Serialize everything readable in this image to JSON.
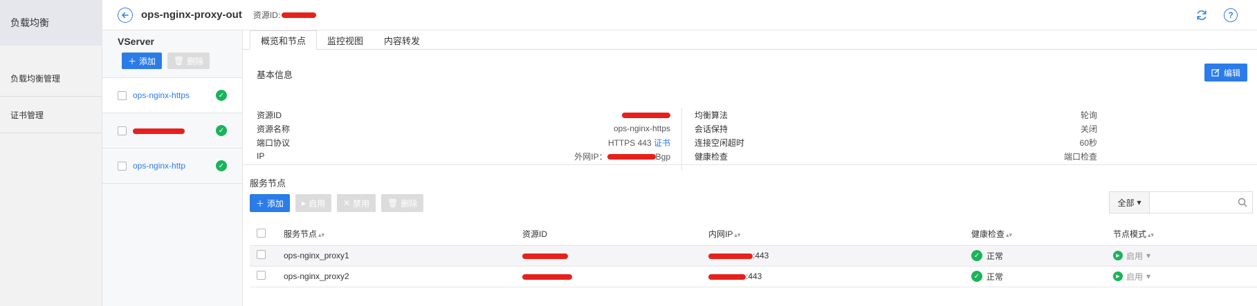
{
  "nav": {
    "header": "负载均衡",
    "items": [
      {
        "label": "负载均衡管理"
      },
      {
        "label": "证书管理"
      }
    ]
  },
  "topbar": {
    "title": "ops-nginx-proxy-out",
    "resource_id_label": "资源ID:",
    "help_glyph": "?"
  },
  "vserver": {
    "title": "VServer",
    "add_label": "添加",
    "delete_label": "删除",
    "items": [
      {
        "name": "ops-nginx-https",
        "redacted": false
      },
      {
        "name": "",
        "redacted": true
      },
      {
        "name": "ops-nginx-http",
        "redacted": false
      }
    ]
  },
  "tabs": [
    {
      "label": "概览和节点",
      "active": true
    },
    {
      "label": "监控视图",
      "active": false
    },
    {
      "label": "内容转发",
      "active": false
    }
  ],
  "basic": {
    "title": "基本信息",
    "edit_label": "编辑",
    "left": [
      {
        "key": "资源ID",
        "value": ""
      },
      {
        "key": "资源名称",
        "value": "ops-nginx-https"
      },
      {
        "key": "端口协议",
        "value": "HTTPS 443",
        "link": "证书"
      },
      {
        "key": "IP",
        "prefix": "外网IP：",
        "suffix": "Bgp"
      }
    ],
    "right": [
      {
        "key": "均衡算法",
        "value": "轮询"
      },
      {
        "key": "会话保持",
        "value": "关闭"
      },
      {
        "key": "连接空闲超时",
        "value": "60秒"
      },
      {
        "key": "健康检查",
        "value": "端口检查"
      }
    ]
  },
  "nodes": {
    "title": "服务节点",
    "buttons": {
      "add": "添加",
      "enable": "启用",
      "disable": "禁用",
      "delete": "删除"
    },
    "filter": {
      "selected": "全部",
      "placeholder": ""
    },
    "columns": {
      "node": "服务节点",
      "resource_id": "资源ID",
      "private_ip": "内网IP",
      "health": "健康检查",
      "mode": "节点模式"
    },
    "rows": [
      {
        "name": "ops-nginx_proxy1",
        "port": ":443",
        "health": "正常",
        "mode": "启用"
      },
      {
        "name": "ops-nginx_proxy2",
        "port": ":443",
        "health": "正常",
        "mode": "启用"
      }
    ]
  },
  "colors": {
    "accent": "#2b7ce9",
    "success": "#1bb35a",
    "redaction": "#e8201c"
  },
  "icons": {
    "back": "arrow-left-icon",
    "refresh": "refresh-icon",
    "help": "help-icon",
    "edit": "edit-icon",
    "ok": "check-circle-icon",
    "search": "search-icon"
  }
}
